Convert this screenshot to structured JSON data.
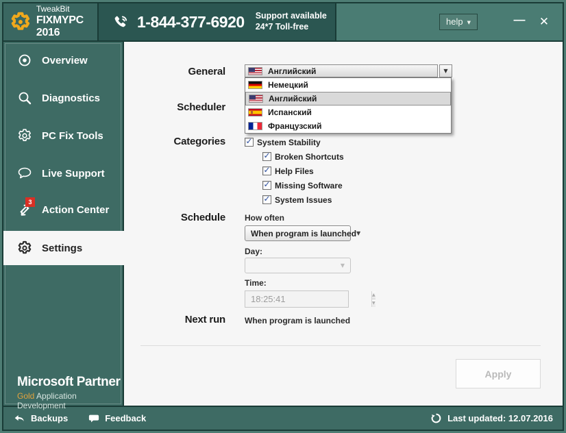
{
  "window": {
    "help_label": "help",
    "minimize_icon": "—",
    "close_icon": "✕"
  },
  "icons": {
    "dropdown_arrow": "▼",
    "spin_up": "▲",
    "spin_down": "▼",
    "check": "✓"
  },
  "header": {
    "brand": {
      "line1": "TweakBit",
      "line2": "FIXMYPC 2016"
    },
    "phone": "1-844-377-6920",
    "support_line1": "Support available",
    "support_line2": "24*7 Toll-free"
  },
  "sidebar": {
    "items": [
      {
        "label": "Overview",
        "icon": "target-icon",
        "active": false
      },
      {
        "label": "Diagnostics",
        "icon": "search-icon",
        "active": false
      },
      {
        "label": "PC Fix Tools",
        "icon": "gear-icon",
        "active": false
      },
      {
        "label": "Live Support",
        "icon": "chat-icon",
        "active": false
      },
      {
        "label": "Action Center",
        "icon": "arrows-icon",
        "badge": "3",
        "active": false
      },
      {
        "label": "Settings",
        "icon": "gear-icon",
        "active": true
      }
    ],
    "partner": {
      "title": "Microsoft Partner",
      "gold": "Gold",
      "subtitle": " Application Development"
    }
  },
  "settings": {
    "general": {
      "label": "General",
      "selected": "Английский",
      "selected_flag": "us",
      "options": [
        {
          "label": "Немецкий",
          "flag": "de",
          "selected": false
        },
        {
          "label": "Английский",
          "flag": "us",
          "selected": true
        },
        {
          "label": "Испанский",
          "flag": "es",
          "selected": false
        },
        {
          "label": "Французский",
          "flag": "fr",
          "selected": false
        }
      ]
    },
    "scheduler_label": "Scheduler",
    "categories": {
      "label": "Categories",
      "parent": {
        "label": "System Stability",
        "checked": true
      },
      "children": [
        {
          "label": "Broken Shortcuts",
          "checked": true
        },
        {
          "label": "Help Files",
          "checked": true
        },
        {
          "label": "Missing Software",
          "checked": true
        },
        {
          "label": "System Issues",
          "checked": true
        }
      ]
    },
    "schedule": {
      "label": "Schedule",
      "how_often_label": "How often",
      "how_often_value": "When program is launched",
      "day_label": "Day:",
      "day_value": "",
      "time_label": "Time:",
      "time_value": "18:25:41"
    },
    "next_run": {
      "label": "Next run",
      "value": "When program is launched"
    },
    "apply_label": "Apply"
  },
  "footer": {
    "backups_label": "Backups",
    "feedback_label": "Feedback",
    "last_updated": "Last updated: 12.07.2016"
  },
  "colors": {
    "sidebar_teal": "#3e6b64",
    "header_dark_teal": "#2b5651",
    "header_light_teal": "#4a7c73",
    "frame_outer": "#4e7d74",
    "frame_line": "#193b36",
    "badge_red": "#d93025",
    "gold": "#e2a33d",
    "logo_orange": "#f0a81c",
    "content_bg": "#f6f6f6"
  }
}
